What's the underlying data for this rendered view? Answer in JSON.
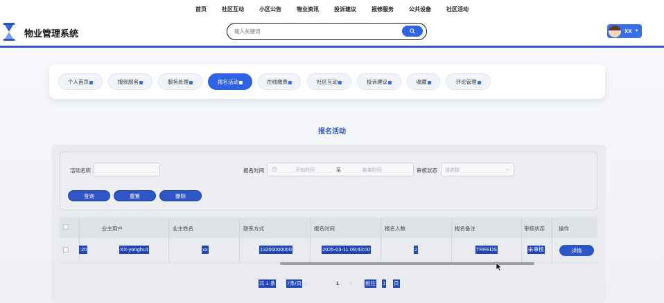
{
  "topnav": [
    "首页",
    "社区互动",
    "小区公告",
    "物业资讯",
    "投诉建议",
    "报修服务",
    "公共设备",
    "社区活动"
  ],
  "header": {
    "title": "物业管理系统",
    "search_placeholder": "输入关键词",
    "user_name": "XX"
  },
  "tabs": [
    "个人首页",
    "报修服务",
    "服务处理",
    "报名活动",
    "在线缴费",
    "社区互动",
    "投诉建议",
    "收藏",
    "评论管理"
  ],
  "active_tab": "报名活动",
  "page_title": "报名活动",
  "filters": {
    "activity_name_label": "活动名称",
    "signup_time_label": "报名时间",
    "start_placeholder": "开始时间",
    "range_sep": "至",
    "end_placeholder": "结束时间",
    "status_label": "审核状态",
    "status_placeholder": "请选择"
  },
  "buttons": {
    "query": "查询",
    "reset": "重置",
    "delete": "删除"
  },
  "table": {
    "columns": [
      "业主用户",
      "业主姓名",
      "联系方式",
      "报名时间",
      "报名人数",
      "报名备注",
      "审核状态",
      "操作"
    ],
    "rows": [
      {
        "prefix": ":20",
        "owner_user": "XX-yonghu1",
        "owner_name": "xx",
        "phone": "13200000000",
        "signup_time": "2025-03-11 09:43:00",
        "count": "2",
        "note": "TRFEDS",
        "status": "未审核",
        "action": "详情"
      }
    ]
  },
  "pagination": {
    "total": "共 1 条",
    "page_size": "7条/页",
    "current_page": "1",
    "goto_label": "前往",
    "goto_value": "1",
    "page_unit": "页"
  }
}
